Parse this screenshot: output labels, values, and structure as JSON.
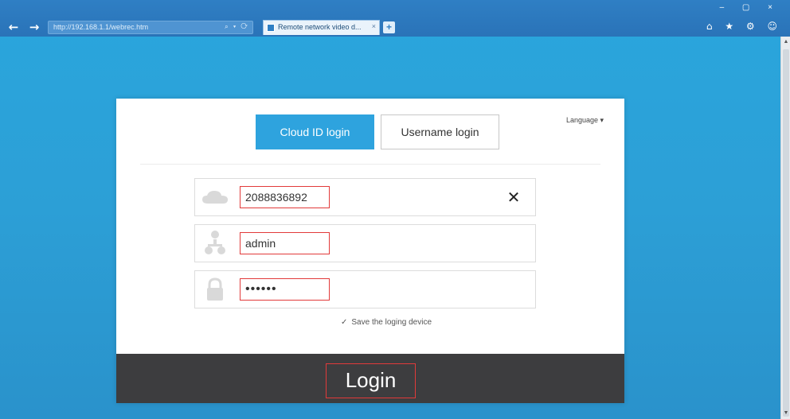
{
  "browser": {
    "back_glyph": "←",
    "forward_glyph": "→",
    "address": "http://192.168.1.1/webrec.htm",
    "address_tools": "⌕ ▾ ⟳",
    "tab_title": "Remote network video d...",
    "tab_close": "×",
    "new_tab": "+",
    "window_controls": "– ▢ ×",
    "chrome_icons": "⌂ ★ ⚙ ☺"
  },
  "login": {
    "tabs": {
      "cloud": "Cloud ID login",
      "username": "Username login"
    },
    "language": "Language ▾",
    "fields": {
      "cloud_id": "2088836892",
      "username": "admin",
      "password": "••••••"
    },
    "clear": "✕",
    "save_check": "✓",
    "save_label": "Save the loging device",
    "button": "Login"
  },
  "colors": {
    "accent": "#2ea3de",
    "background": "#2aa6dd",
    "login_bar": "#3d3d3f",
    "highlight": "#e23a3a"
  },
  "icons": {
    "cloud": "cloud-icon",
    "user": "user-icon",
    "lock": "lock-icon",
    "clear": "close-icon"
  }
}
